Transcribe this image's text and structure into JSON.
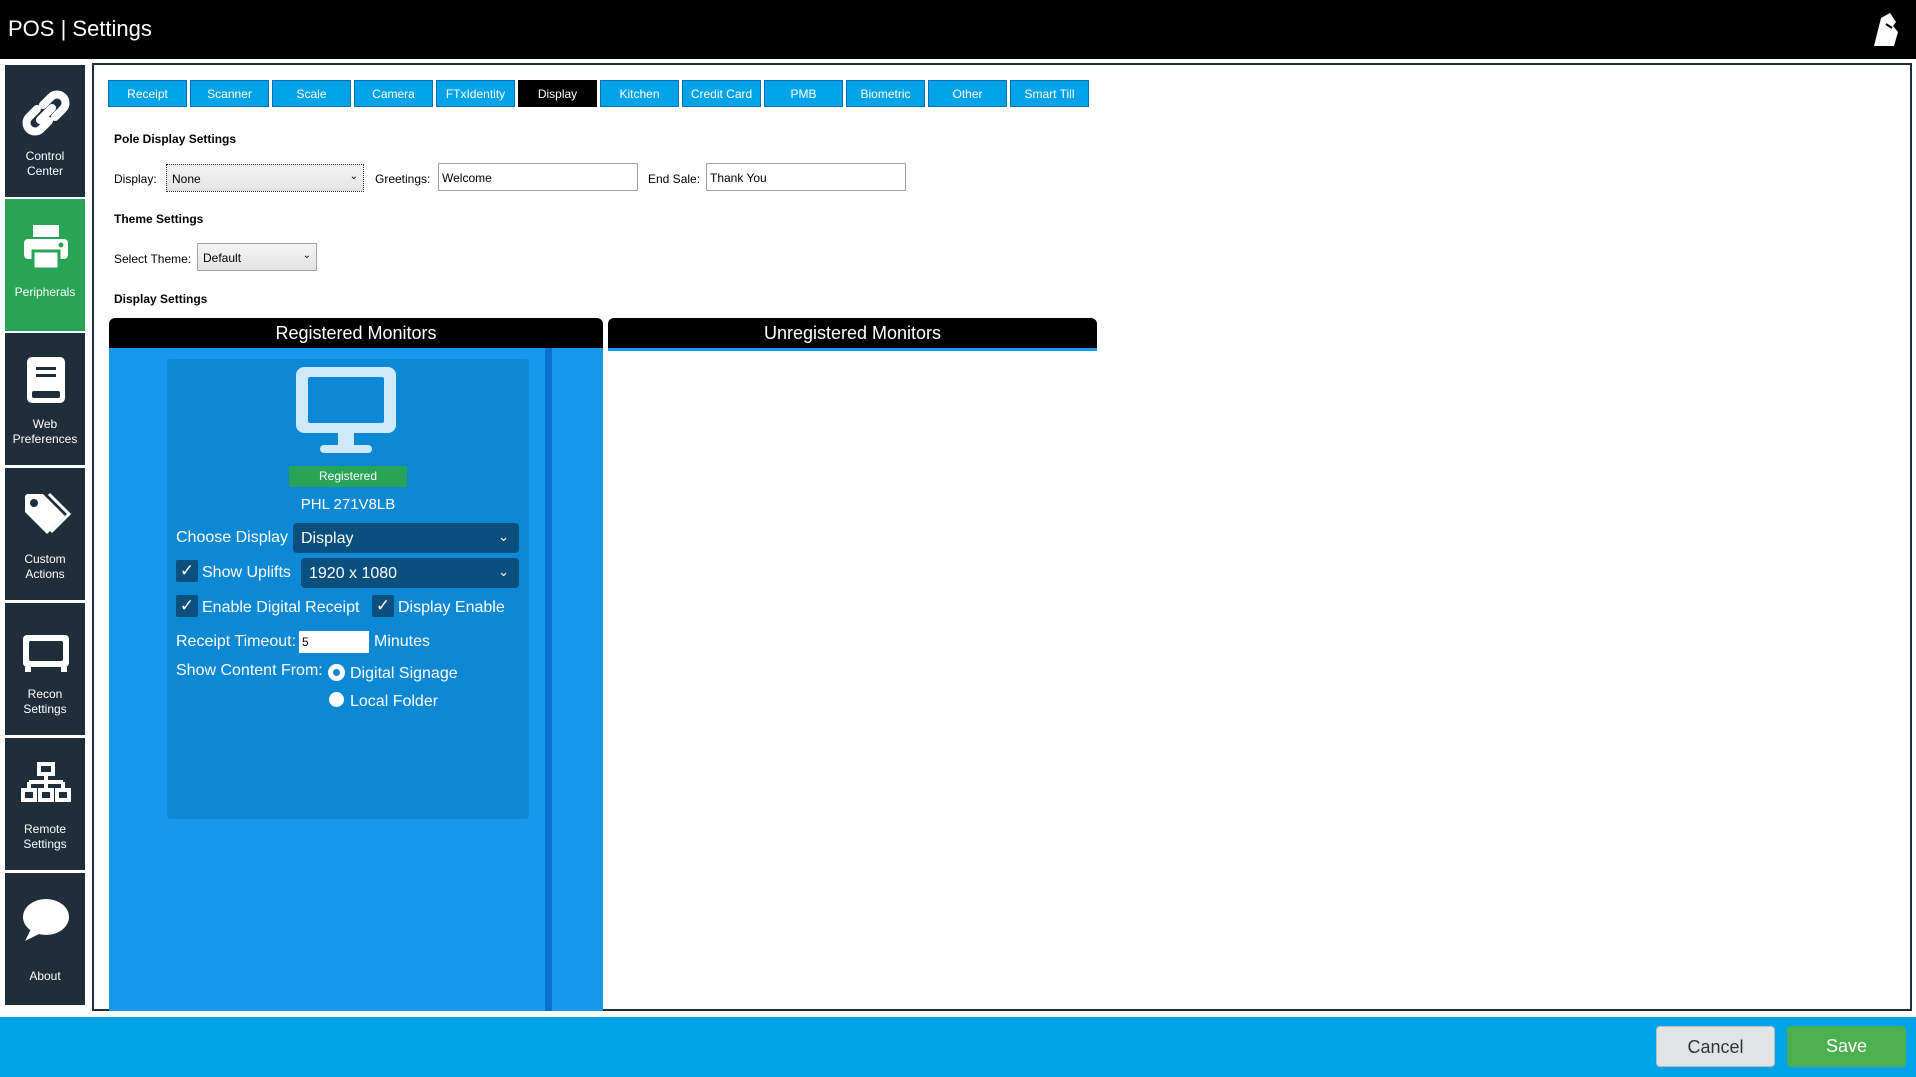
{
  "window": {
    "title": "POS | Settings"
  },
  "sidebar": {
    "items": [
      {
        "label": "Control\nCenter",
        "icon": "link-icon"
      },
      {
        "label": "Peripherals",
        "icon": "printer-icon",
        "active": true
      },
      {
        "label": "Web\nPreferences",
        "icon": "book-icon"
      },
      {
        "label": "Custom\nActions",
        "icon": "tags-icon"
      },
      {
        "label": "Recon\nSettings",
        "icon": "monitor-icon"
      },
      {
        "label": "Remote\nSettings",
        "icon": "network-icon"
      },
      {
        "label": "About",
        "icon": "chat-bubble-icon"
      }
    ]
  },
  "tabs": [
    "Receipt",
    "Scanner",
    "Scale",
    "Camera",
    "FTxIdentity",
    "Display",
    "Kitchen",
    "Credit Card",
    "PMB",
    "Biometric",
    "Other",
    "Smart Till"
  ],
  "active_tab": "Display",
  "pole_display": {
    "section_title": "Pole Display Settings",
    "display_label": "Display:",
    "display_value": "None",
    "greetings_label": "Greetings:",
    "greetings_value": "Welcome",
    "end_sale_label": "End Sale:",
    "end_sale_value": "Thank You"
  },
  "theme": {
    "section_title": "Theme Settings",
    "select_label": "Select Theme:",
    "select_value": "Default"
  },
  "display_settings": {
    "section_title": "Display Settings",
    "registered_header": "Registered Monitors",
    "unregistered_header": "Unregistered Monitors",
    "monitor": {
      "status_badge": "Registered",
      "name": "PHL 271V8LB",
      "choose_display_label": "Choose Display",
      "choose_display_value": "Display",
      "show_uplifts_label": "Show Uplifts",
      "show_uplifts_checked": true,
      "resolution_value": "1920 x 1080",
      "enable_digital_receipt_label": "Enable Digital Receipt",
      "enable_digital_receipt_checked": true,
      "display_enable_label": "Display Enable",
      "display_enable_checked": true,
      "receipt_timeout_label": "Receipt Timeout:",
      "receipt_timeout_value": "5",
      "receipt_timeout_unit": "Minutes",
      "show_content_label": "Show Content From:",
      "content_options": [
        "Digital Signage",
        "Local Folder"
      ],
      "content_selected": "Digital Signage"
    }
  },
  "footer": {
    "cancel_label": "Cancel",
    "save_label": "Save"
  },
  "colors": {
    "accent_blue": "#00a2e8",
    "panel_blue": "#1598eb",
    "card_blue": "#0c88d4",
    "green": "#27a456",
    "sidebar_dark": "#1f2e3a"
  }
}
